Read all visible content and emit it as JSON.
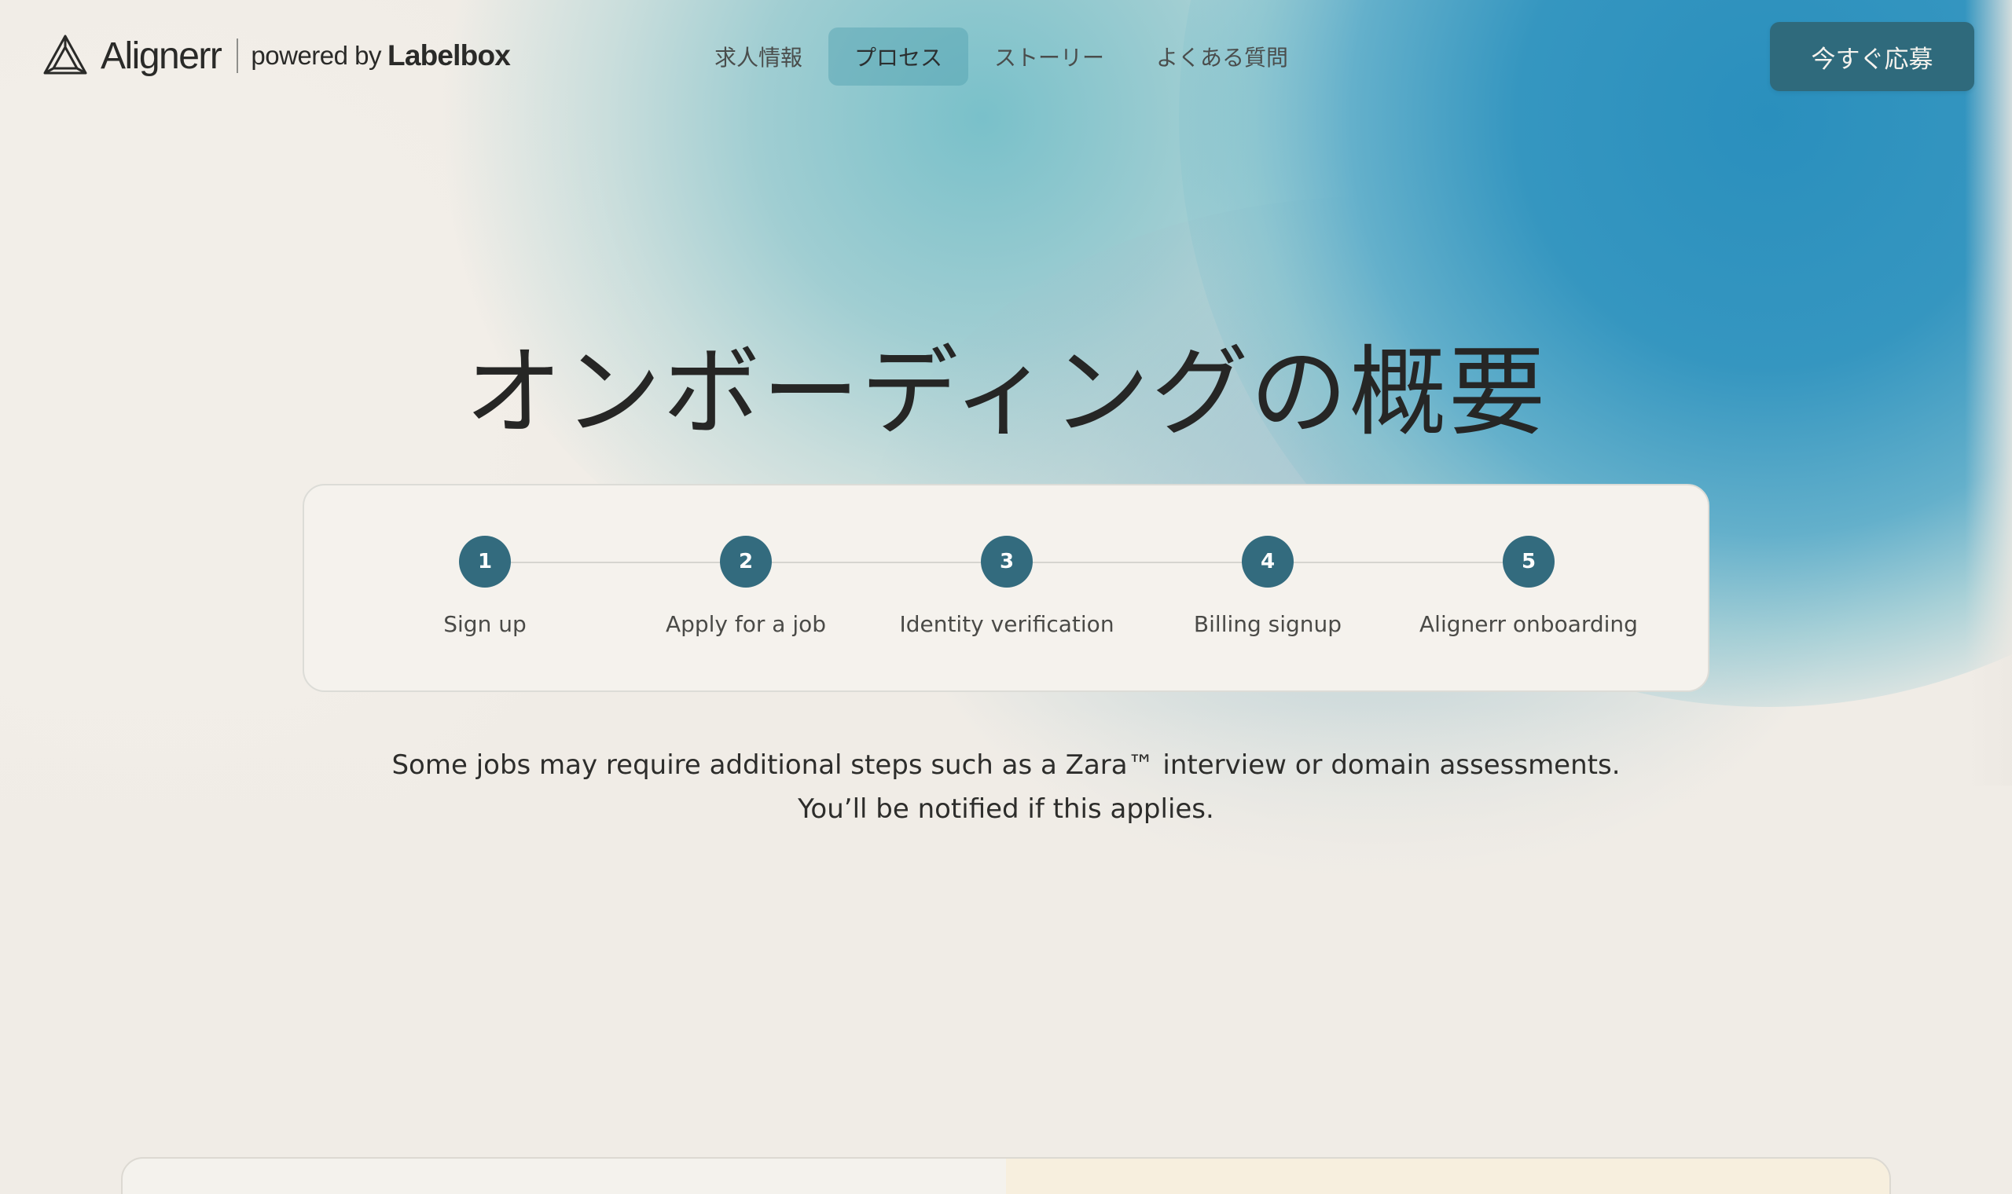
{
  "brand": {
    "name": "Alignerr",
    "powered_by": "powered by",
    "partner": "Labelbox"
  },
  "nav": {
    "links": [
      {
        "label": "求人情報",
        "active": false
      },
      {
        "label": "プロセス",
        "active": true
      },
      {
        "label": "ストーリー",
        "active": false
      },
      {
        "label": "よくある質問",
        "active": false
      }
    ],
    "cta_label": "今すぐ応募"
  },
  "hero": {
    "title": "オンボーディングの概要"
  },
  "steps": [
    {
      "number": "1",
      "label": "Sign up"
    },
    {
      "number": "2",
      "label": "Apply for a job"
    },
    {
      "number": "3",
      "label": "Identity verification"
    },
    {
      "number": "4",
      "label": "Billing signup"
    },
    {
      "number": "5",
      "label": "Alignerr onboarding"
    }
  ],
  "note": {
    "line1": "Some jobs may require additional steps such as a Zara™ interview or domain assessments.",
    "line2": "You’ll be notified if this applies."
  },
  "colors": {
    "accent": "#336b7e",
    "cta_bg": "#2f6a7c",
    "gradient_blue": "#2a8fbd",
    "gradient_teal": "#73bec8",
    "background": "#f0ece6"
  }
}
